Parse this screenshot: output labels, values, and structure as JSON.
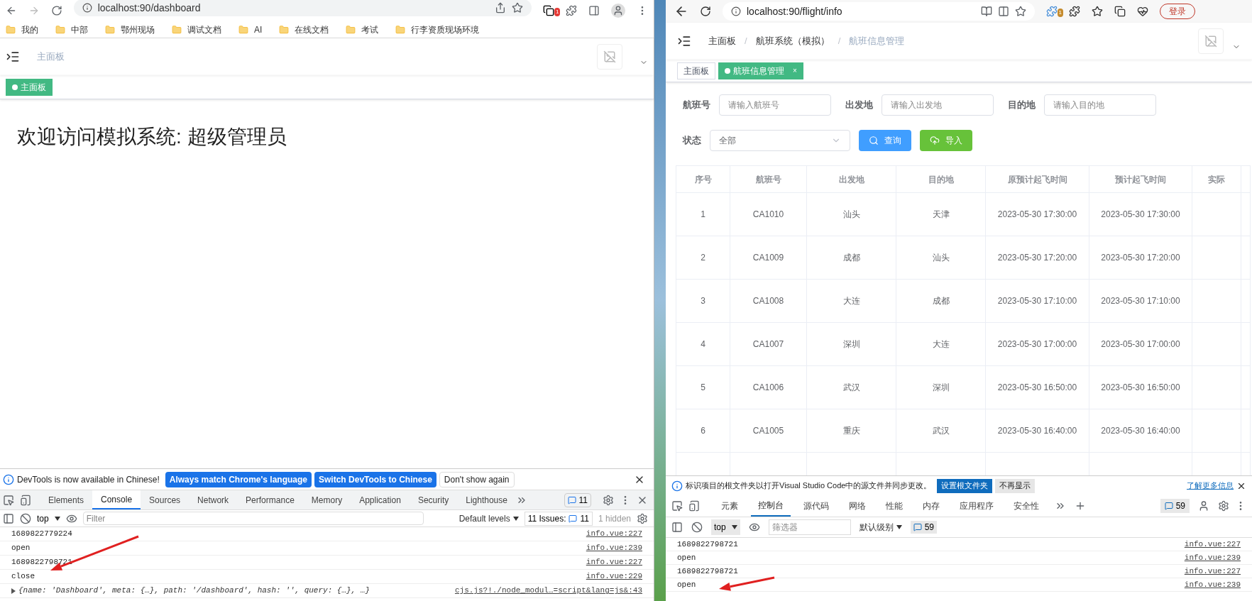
{
  "left_browser": {
    "url": "localhost:90/dashboard",
    "extension_badge": "1",
    "bookmarks": [
      "我的",
      "中部",
      "鄂州现场",
      "调试文档",
      "AI",
      "在线文档",
      "考试",
      "行李资质现场环境"
    ],
    "app": {
      "breadcrumb": [
        "主面板"
      ],
      "tags": [
        {
          "label": "主面板",
          "selected": true
        }
      ],
      "welcome": "欢迎访问模拟系统: 超级管理员"
    },
    "devtools": {
      "notice": "DevTools is now available in Chinese!",
      "notice_buttons": [
        {
          "label": "Always match Chrome's language",
          "kind": "primary"
        },
        {
          "label": "Switch DevTools to Chinese",
          "kind": "primary"
        },
        {
          "label": "Don't show again",
          "kind": "plain"
        }
      ],
      "tabs": [
        {
          "label": "Elements",
          "selected": false
        },
        {
          "label": "Console",
          "selected": true
        },
        {
          "label": "Sources",
          "selected": false
        },
        {
          "label": "Network",
          "selected": false
        },
        {
          "label": "Performance",
          "selected": false
        },
        {
          "label": "Memory",
          "selected": false
        },
        {
          "label": "Application",
          "selected": false
        },
        {
          "label": "Security",
          "selected": false
        },
        {
          "label": "Lighthouse",
          "selected": false
        }
      ],
      "issues_badge": "11",
      "context": "top",
      "filter_placeholder": "Filter",
      "levels": "Default levels",
      "issues_label": "11 Issues:",
      "issues_count": "11",
      "hidden": "1 hidden",
      "logs": [
        {
          "kind": "text",
          "text": "1689822779224",
          "source": "info.vue:227"
        },
        {
          "kind": "text",
          "text": "open",
          "source": "info.vue:239"
        },
        {
          "kind": "text",
          "text": "1689822798721",
          "source": "info.vue:227"
        },
        {
          "kind": "text",
          "text": "close",
          "source": "info.vue:229"
        },
        {
          "kind": "object",
          "text": "{name: 'Dashboard', meta: {…}, path: '/dashboard', hash: '', query: {…}, …}",
          "source": "cjs.js?!./node_modul…=script&lang=js&:43"
        }
      ]
    }
  },
  "right_browser": {
    "url": "localhost:90/flight/info",
    "extension_badge": "1",
    "login": "登录",
    "app": {
      "breadcrumb": [
        "主面板",
        "航班系统（模拟）",
        "航班信息管理"
      ],
      "breadcrumb_separator": "/",
      "tags": [
        {
          "label": "主面板",
          "selected": false
        },
        {
          "label": "航班信息管理",
          "selected": true,
          "close": "×"
        }
      ],
      "fields": [
        {
          "label": "航班号",
          "placeholder": "请输入航班号"
        },
        {
          "label": "出发地",
          "placeholder": "请输入出发地"
        },
        {
          "label": "目的地",
          "placeholder": "请输入目的地"
        }
      ],
      "status": {
        "label": "状态",
        "value": "全部"
      },
      "buttons": [
        {
          "kind": "search",
          "label": "查询"
        },
        {
          "kind": "import",
          "label": "导入"
        }
      ],
      "table": {
        "columns": [
          "序号",
          "航班号",
          "出发地",
          "目的地",
          "原预计起飞时间",
          "预计起飞时间",
          "实际"
        ],
        "rows": [
          [
            "1",
            "CA1010",
            "汕头",
            "天津",
            "2023-05-30 17:30:00",
            "2023-05-30 17:30:00"
          ],
          [
            "2",
            "CA1009",
            "成都",
            "汕头",
            "2023-05-30 17:20:00",
            "2023-05-30 17:20:00"
          ],
          [
            "3",
            "CA1008",
            "大连",
            "成都",
            "2023-05-30 17:10:00",
            "2023-05-30 17:10:00"
          ],
          [
            "4",
            "CA1007",
            "深圳",
            "大连",
            "2023-05-30 17:00:00",
            "2023-05-30 17:00:00"
          ],
          [
            "5",
            "CA1006",
            "武汉",
            "深圳",
            "2023-05-30 16:50:00",
            "2023-05-30 16:50:00"
          ],
          [
            "6",
            "CA1005",
            "重庆",
            "武汉",
            "2023-05-30 16:40:00",
            "2023-05-30 16:40:00"
          ]
        ]
      }
    },
    "devtools": {
      "notice": "标识项目的根文件夹以打开Visual Studio Code中的源文件并同步更改。",
      "notice_buttons": [
        {
          "label": "设置根文件夹",
          "kind": "primary"
        },
        {
          "label": "不再显示",
          "kind": "plain"
        }
      ],
      "learn_more": "了解更多信息",
      "tabs": [
        {
          "label": "元素",
          "selected": false
        },
        {
          "label": "控制台",
          "selected": true
        },
        {
          "label": "源代码",
          "selected": false
        },
        {
          "label": "网络",
          "selected": false
        },
        {
          "label": "性能",
          "selected": false
        },
        {
          "label": "内存",
          "selected": false
        },
        {
          "label": "应用程序",
          "selected": false
        },
        {
          "label": "安全性",
          "selected": false
        }
      ],
      "issues_badge": "59",
      "context": "top",
      "filter_placeholder": "筛选器",
      "levels": "默认级别",
      "issues_count": "59",
      "logs": [
        {
          "kind": "text",
          "text": "1689822798721",
          "source": "info.vue:227"
        },
        {
          "kind": "text",
          "text": "open",
          "source": "info.vue:239"
        },
        {
          "kind": "text",
          "text": "1689822798721",
          "source": "info.vue:227"
        },
        {
          "kind": "text",
          "text": "open",
          "source": "info.vue:239"
        }
      ]
    }
  }
}
